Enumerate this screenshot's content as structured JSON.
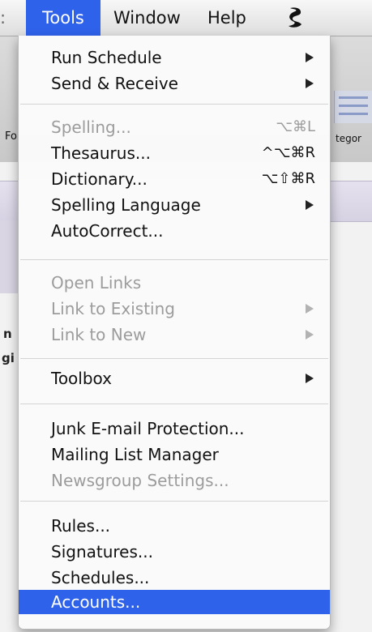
{
  "menubar": {
    "items": [
      {
        "label": "Tools"
      },
      {
        "label": "Window"
      },
      {
        "label": "Help"
      }
    ],
    "script_icon": "script-icon"
  },
  "background": {
    "fragment_left": "Fo",
    "fragment_right": "tegor",
    "fragment_n": "n",
    "fragment_gi": "gi"
  },
  "menu": {
    "items": [
      {
        "label": "Run Schedule",
        "shortcut": "",
        "submenu": true,
        "enabled": true
      },
      {
        "label": "Send & Receive",
        "shortcut": "",
        "submenu": true,
        "enabled": true
      },
      {
        "label": "Spelling...",
        "shortcut": "⌥⌘L",
        "submenu": false,
        "enabled": false
      },
      {
        "label": "Thesaurus...",
        "shortcut": "^⌥⌘R",
        "submenu": false,
        "enabled": true
      },
      {
        "label": "Dictionary...",
        "shortcut": "⌥⇧⌘R",
        "submenu": false,
        "enabled": true
      },
      {
        "label": "Spelling Language",
        "shortcut": "",
        "submenu": true,
        "enabled": true
      },
      {
        "label": "AutoCorrect...",
        "shortcut": "",
        "submenu": false,
        "enabled": true
      },
      {
        "label": "Open Links",
        "shortcut": "",
        "submenu": false,
        "enabled": false
      },
      {
        "label": "Link to Existing",
        "shortcut": "",
        "submenu": true,
        "enabled": false
      },
      {
        "label": "Link to New",
        "shortcut": "",
        "submenu": true,
        "enabled": false
      },
      {
        "label": "Toolbox",
        "shortcut": "",
        "submenu": true,
        "enabled": true
      },
      {
        "label": "Junk E-mail Protection...",
        "shortcut": "",
        "submenu": false,
        "enabled": true
      },
      {
        "label": "Mailing List Manager",
        "shortcut": "",
        "submenu": false,
        "enabled": true
      },
      {
        "label": "Newsgroup Settings...",
        "shortcut": "",
        "submenu": false,
        "enabled": false
      },
      {
        "label": "Rules...",
        "shortcut": "",
        "submenu": false,
        "enabled": true
      },
      {
        "label": "Signatures...",
        "shortcut": "",
        "submenu": false,
        "enabled": true
      },
      {
        "label": "Schedules...",
        "shortcut": "",
        "submenu": false,
        "enabled": true
      },
      {
        "label": "Accounts...",
        "shortcut": "",
        "submenu": false,
        "enabled": true,
        "selected": true
      }
    ]
  },
  "colors": {
    "highlight": "#2f62ea",
    "disabled_text": "#9c9c9c"
  }
}
